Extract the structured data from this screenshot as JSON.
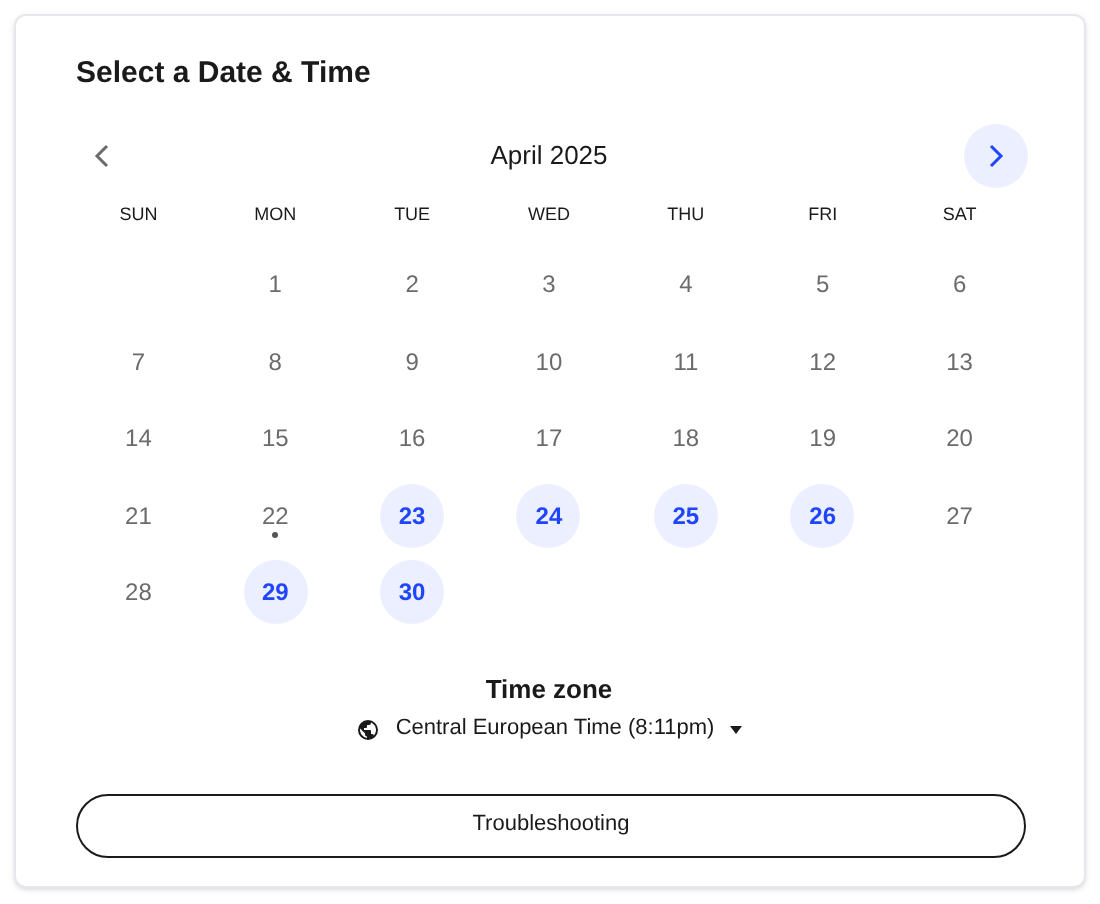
{
  "title": "Select a Date & Time",
  "calendar": {
    "month": "April 2025",
    "prev": {
      "disabled": true
    },
    "next": {
      "disabled": false
    },
    "weekdays": [
      "SUN",
      "MON",
      "TUE",
      "WED",
      "THU",
      "FRI",
      "SAT"
    ],
    "weeks": [
      [
        {
          "label": "1",
          "available": false,
          "today": false
        },
        {
          "label": "2",
          "available": false,
          "today": false
        },
        {
          "label": "3",
          "available": false,
          "today": false
        },
        {
          "label": "4",
          "available": false,
          "today": false
        },
        {
          "label": "5",
          "available": false,
          "today": false
        },
        {
          "label": "6",
          "available": false,
          "today": false
        }
      ],
      [
        {
          "label": "7",
          "available": false,
          "today": false
        },
        {
          "label": "8",
          "available": false,
          "today": false
        },
        {
          "label": "9",
          "available": false,
          "today": false
        },
        {
          "label": "10",
          "available": false,
          "today": false
        },
        {
          "label": "11",
          "available": false,
          "today": false
        },
        {
          "label": "12",
          "available": false,
          "today": false
        },
        {
          "label": "13",
          "available": false,
          "today": false
        }
      ],
      [
        {
          "label": "14",
          "available": false,
          "today": false
        },
        {
          "label": "15",
          "available": false,
          "today": false
        },
        {
          "label": "16",
          "available": false,
          "today": false
        },
        {
          "label": "17",
          "available": false,
          "today": false
        },
        {
          "label": "18",
          "available": false,
          "today": false
        },
        {
          "label": "19",
          "available": false,
          "today": false
        },
        {
          "label": "20",
          "available": false,
          "today": false
        }
      ],
      [
        {
          "label": "21",
          "available": false,
          "today": false
        },
        {
          "label": "22",
          "available": false,
          "today": true
        },
        {
          "label": "23",
          "available": true,
          "today": false
        },
        {
          "label": "24",
          "available": true,
          "today": false
        },
        {
          "label": "25",
          "available": true,
          "today": false
        },
        {
          "label": "26",
          "available": true,
          "today": false
        },
        {
          "label": "27",
          "available": false,
          "today": false
        }
      ],
      [
        {
          "label": "28",
          "available": false,
          "today": false
        },
        {
          "label": "29",
          "available": true,
          "today": false
        },
        {
          "label": "30",
          "available": true,
          "today": false
        }
      ]
    ]
  },
  "time_zone": {
    "label": "Time zone",
    "value": "Central European Time (8:11pm)"
  },
  "button": "Troubleshooting"
}
